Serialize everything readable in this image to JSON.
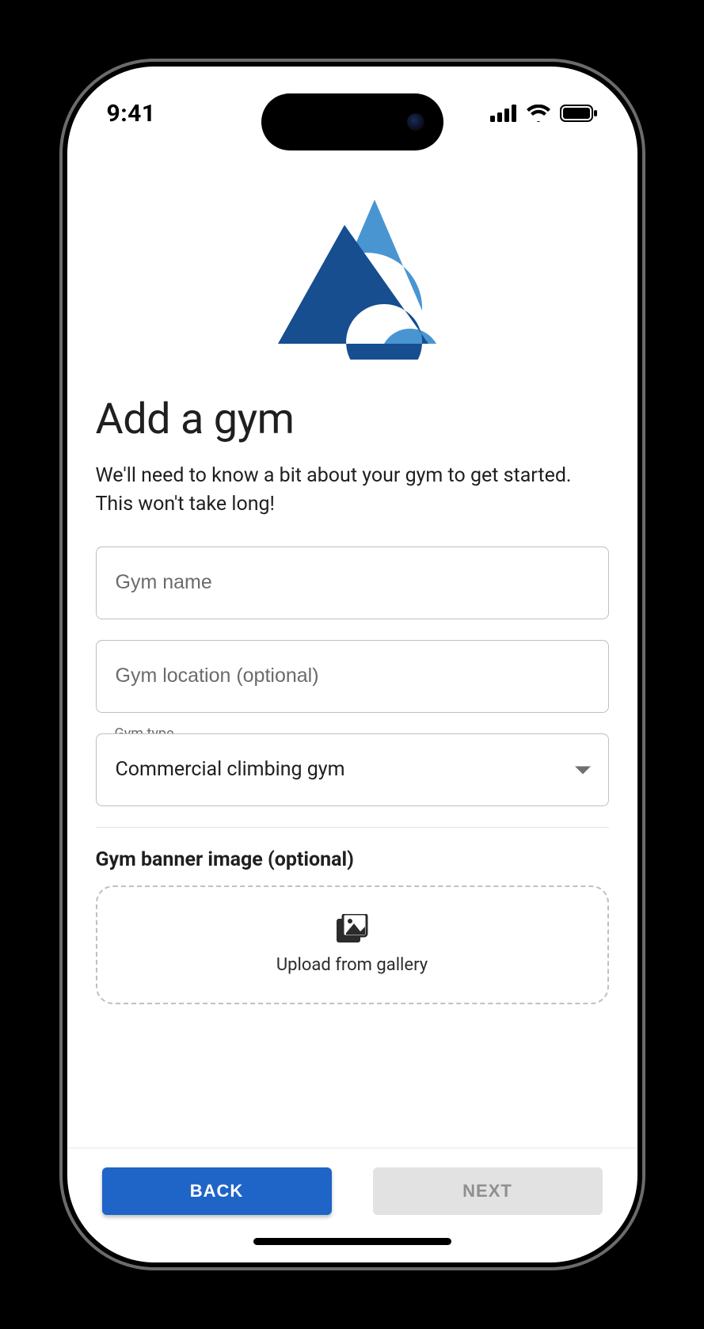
{
  "status": {
    "time": "9:41"
  },
  "logo": {
    "name": "app-mountain-logo",
    "colors": {
      "dark": "#164e8f",
      "light": "#4995d2"
    }
  },
  "page": {
    "title": "Add a gym",
    "subtitle": "We'll need to know a bit about your gym to get started. This won't take long!"
  },
  "form": {
    "gym_name": {
      "placeholder": "Gym name",
      "value": ""
    },
    "gym_location": {
      "placeholder": "Gym location (optional)",
      "value": ""
    },
    "gym_type": {
      "label": "Gym type",
      "selected": "Commercial climbing gym"
    },
    "banner": {
      "section_label": "Gym banner image (optional)",
      "upload_label": "Upload from gallery"
    }
  },
  "footer": {
    "back_label": "BACK",
    "next_label": "NEXT",
    "next_enabled": false
  }
}
